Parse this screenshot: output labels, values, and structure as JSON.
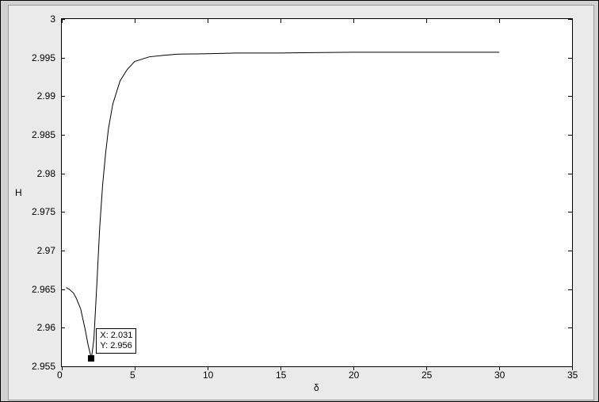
{
  "chart_data": {
    "type": "line",
    "title": "",
    "xlabel": "δ",
    "ylabel": "H",
    "xlim": [
      0,
      35
    ],
    "ylim": [
      2.955,
      3.0
    ],
    "xticks": [
      0,
      5,
      10,
      15,
      20,
      25,
      30,
      35
    ],
    "yticks": [
      2.955,
      2.96,
      2.965,
      2.97,
      2.975,
      2.98,
      2.985,
      2.99,
      2.995,
      3.0
    ],
    "x": [
      0.3,
      0.5,
      0.8,
      1.0,
      1.3,
      1.6,
      1.8,
      2.031,
      2.2,
      2.4,
      2.6,
      2.8,
      3.0,
      3.2,
      3.5,
      4.0,
      4.5,
      5.0,
      6.0,
      7.0,
      8.0,
      10.0,
      12.0,
      15.0,
      20.0,
      25.0,
      30.0
    ],
    "y": [
      2.9652,
      2.965,
      2.9645,
      2.9638,
      2.9624,
      2.9598,
      2.9578,
      2.956,
      2.9585,
      2.9655,
      2.973,
      2.9785,
      2.9825,
      2.9858,
      2.989,
      2.992,
      2.9935,
      2.9945,
      2.9951,
      2.9953,
      2.99545,
      2.9955,
      2.9956,
      2.9956,
      2.9957,
      2.9957,
      2.9957
    ],
    "datatip": {
      "x": 2.031,
      "y": 2.956,
      "xlabel": "X: 2.031",
      "ylabel": "Y: 2.956"
    }
  }
}
